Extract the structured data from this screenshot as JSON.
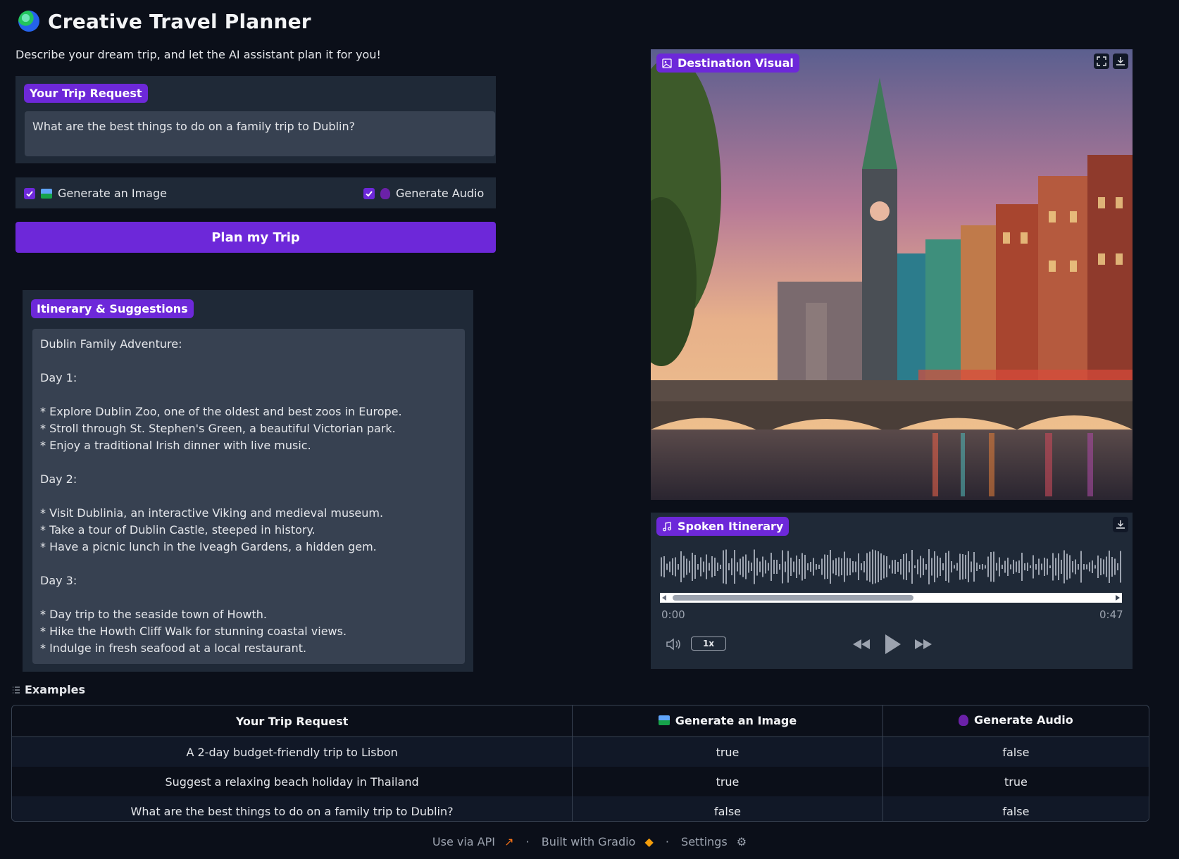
{
  "app": {
    "title": "Creative Travel Planner",
    "description": "Describe your dream trip, and let the AI assistant plan it for you!"
  },
  "trip_request": {
    "label": "Your Trip Request",
    "value": "What are the best things to do on a family trip to Dublin?"
  },
  "options": {
    "generate_image": {
      "label": "Generate an Image",
      "checked": true
    },
    "generate_audio": {
      "label": "Generate Audio",
      "checked": true
    }
  },
  "plan_button": {
    "label": "Plan my Trip"
  },
  "itinerary": {
    "label": "Itinerary & Suggestions",
    "text": "Dublin Family Adventure:\n\nDay 1:\n\n* Explore Dublin Zoo, one of the oldest and best zoos in Europe.\n* Stroll through St. Stephen's Green, a beautiful Victorian park.\n* Enjoy a traditional Irish dinner with live music.\n\nDay 2:\n\n* Visit Dublinia, an interactive Viking and medieval museum.\n* Take a tour of Dublin Castle, steeped in history.\n* Have a picnic lunch in the Iveagh Gardens, a hidden gem.\n\nDay 3:\n\n* Day trip to the seaside town of Howth.\n* Hike the Howth Cliff Walk for stunning coastal views.\n* Indulge in fresh seafood at a local restaurant."
  },
  "destination_visual": {
    "label": "Destination Visual"
  },
  "audio": {
    "label": "Spoken Itinerary",
    "current_time": "0:00",
    "duration": "0:47",
    "playback_rate": "1x"
  },
  "examples": {
    "label": "Examples",
    "headers": [
      "Your Trip Request",
      "Generate an Image",
      "Generate Audio"
    ],
    "rows": [
      [
        "A 2-day budget-friendly trip to Lisbon",
        "true",
        "false"
      ],
      [
        "Suggest a relaxing beach holiday in Thailand",
        "true",
        "true"
      ],
      [
        "What are the best things to do on a family trip to Dublin?",
        "false",
        "false"
      ]
    ]
  },
  "footer": {
    "api": "Use via API",
    "built": "Built with Gradio",
    "settings": "Settings",
    "separator": "·"
  },
  "colors": {
    "background": "#0b0f19",
    "panel": "#1f2937",
    "input": "#374151",
    "accent": "#6d28d9"
  }
}
